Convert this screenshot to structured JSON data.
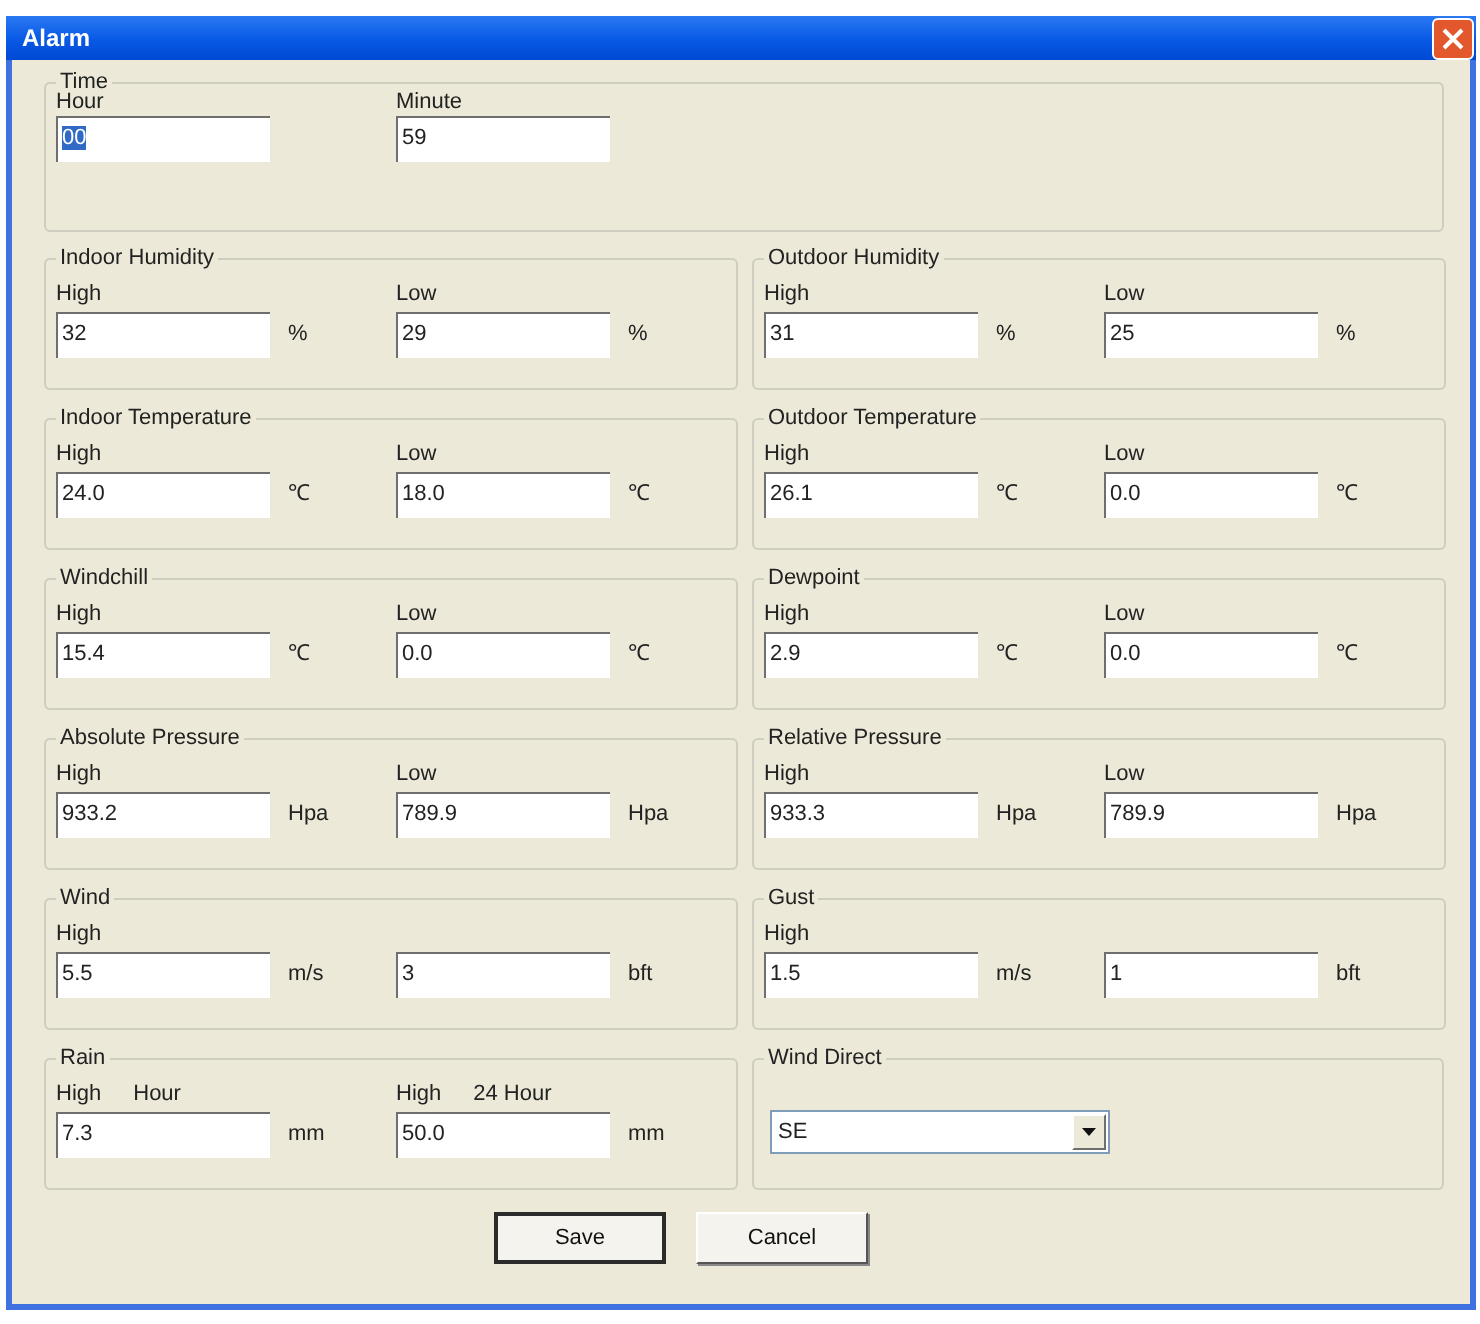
{
  "window": {
    "title": "Alarm"
  },
  "time": {
    "title": "Time",
    "fields": [
      {
        "label": "Hour",
        "value": "00",
        "selected": true
      },
      {
        "label": "Minute",
        "value": "59",
        "selected": false
      }
    ]
  },
  "groups": [
    {
      "title": "Indoor Humidity",
      "kind": "fields",
      "fields": [
        {
          "label": "High",
          "value": "32",
          "unit": "%"
        },
        {
          "label": "Low",
          "value": "29",
          "unit": "%"
        }
      ]
    },
    {
      "title": "Outdoor Humidity",
      "kind": "fields",
      "fields": [
        {
          "label": "High",
          "value": "31",
          "unit": "%"
        },
        {
          "label": "Low",
          "value": "25",
          "unit": "%"
        }
      ]
    },
    {
      "title": "Indoor Temperature",
      "kind": "fields",
      "fields": [
        {
          "label": "High",
          "value": "24.0",
          "unit": "℃"
        },
        {
          "label": "Low",
          "value": "18.0",
          "unit": "℃"
        }
      ]
    },
    {
      "title": "Outdoor Temperature",
      "kind": "fields",
      "fields": [
        {
          "label": "High",
          "value": "26.1",
          "unit": "℃"
        },
        {
          "label": "Low",
          "value": "0.0",
          "unit": "℃"
        }
      ]
    },
    {
      "title": "Windchill",
      "kind": "fields",
      "fields": [
        {
          "label": "High",
          "value": "15.4",
          "unit": "℃"
        },
        {
          "label": "Low",
          "value": "0.0",
          "unit": "℃"
        }
      ]
    },
    {
      "title": "Dewpoint",
      "kind": "fields",
      "fields": [
        {
          "label": "High",
          "value": "2.9",
          "unit": "℃"
        },
        {
          "label": "Low",
          "value": "0.0",
          "unit": "℃"
        }
      ]
    },
    {
      "title": "Absolute Pressure",
      "kind": "fields",
      "fields": [
        {
          "label": "High",
          "value": "933.2",
          "unit": "Hpa"
        },
        {
          "label": "Low",
          "value": "789.9",
          "unit": "Hpa"
        }
      ]
    },
    {
      "title": "Relative Pressure",
      "kind": "fields",
      "fields": [
        {
          "label": "High",
          "value": "933.3",
          "unit": "Hpa"
        },
        {
          "label": "Low",
          "value": "789.9",
          "unit": "Hpa"
        }
      ]
    },
    {
      "title": "Wind",
      "kind": "fields",
      "fields": [
        {
          "label": "High",
          "value": "5.5",
          "unit": "m/s"
        },
        {
          "value": "3",
          "unit": "bft"
        }
      ]
    },
    {
      "title": "Gust",
      "kind": "fields",
      "fields": [
        {
          "label": "High",
          "value": "1.5",
          "unit": "m/s"
        },
        {
          "value": "1",
          "unit": "bft"
        }
      ]
    },
    {
      "title": "Rain",
      "kind": "fields",
      "fields": [
        {
          "label": "High",
          "sublabel": "Hour",
          "value": "7.3",
          "unit": "mm"
        },
        {
          "label": "High",
          "sublabel": "24 Hour",
          "value": "50.0",
          "unit": "mm"
        }
      ]
    },
    {
      "title": "Wind Direct",
      "kind": "select",
      "value": "SE"
    }
  ],
  "buttons": [
    {
      "label": "Save",
      "default": true
    },
    {
      "label": "Cancel",
      "default": false
    }
  ]
}
